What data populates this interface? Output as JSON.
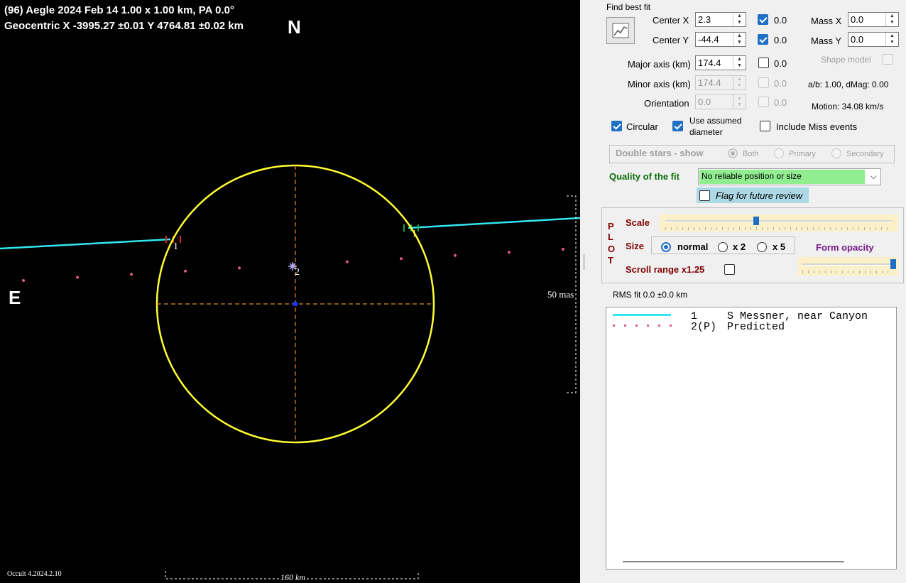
{
  "plot": {
    "title_line1": "(96) Aegle  2024 Feb 14   1.00 x 1.00 km, PA 0.0°",
    "title_line2": "Geocentric  X  -3995.27 ±0.01  Y 4764.81 ±0.02 km",
    "north": "N",
    "east": "E",
    "scale_mas": "50 mas",
    "scale_km": "160 km",
    "version": "Occult 4.2024.2.10",
    "chord1_label_left": "1",
    "chord1_label_right": "1",
    "predicted_label": "2",
    "colors": {
      "background": "#000000",
      "ellipse": "#ffff33",
      "chord": "#33e6f0",
      "predicted": "#e05a7a",
      "axes": "#e08a1e",
      "center": "#1a33ff"
    }
  },
  "fit": {
    "title": "Find best fit",
    "center_x": {
      "label": "Center X",
      "value": "2.3",
      "check_label": "0.0",
      "checked": true
    },
    "center_y": {
      "label": "Center Y",
      "value": "-44.4",
      "check_label": "0.0",
      "checked": true
    },
    "mass_x": {
      "label": "Mass X",
      "value": "0.0"
    },
    "mass_y": {
      "label": "Mass Y",
      "value": "0.0"
    },
    "major_axis": {
      "label": "Major axis (km)",
      "value": "174.4",
      "check_label": "0.0"
    },
    "minor_axis": {
      "label": "Minor axis (km)",
      "value": "174.4",
      "check_label": "0.0"
    },
    "orientation": {
      "label": "Orientation",
      "value": "0.0",
      "check_label": "0.0"
    },
    "shape_model": "Shape model",
    "ab_dmag": "a/b: 1.00, dMag: 0.00",
    "motion": "Motion: 34.08 km/s",
    "circular": "Circular",
    "use_assumed_1": "Use assumed",
    "use_assumed_2": "diameter",
    "include_miss": "Include Miss events"
  },
  "double_stars": {
    "label": "Double stars - show",
    "both": "Both",
    "primary": "Primary",
    "secondary": "Secondary"
  },
  "quality": {
    "label": "Quality of the fit",
    "value": "No reliable position or size",
    "color": "#90ee90"
  },
  "flag_review": "Flag for future review",
  "plot_controls": {
    "side_letters": [
      "P",
      "L",
      "O",
      "T"
    ],
    "scale_label": "Scale",
    "scale_value": 0.4,
    "size_label": "Size",
    "size_normal": "normal",
    "size_x2": "x 2",
    "size_x5": "x 5",
    "form_opacity": "Form opacity",
    "opacity_value": 1.0,
    "scroll_range": "Scroll range x1.25"
  },
  "rms": "RMS fit 0.0 ±0.0 km",
  "legend": [
    {
      "num": "1",
      "text": "S Messner, near Canyon"
    },
    {
      "num": "2(P)",
      "text": "Predicted"
    }
  ]
}
